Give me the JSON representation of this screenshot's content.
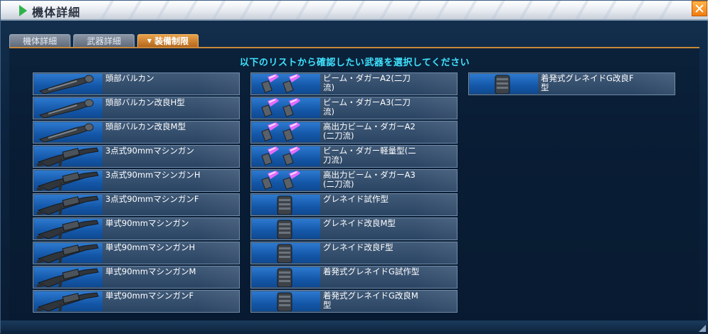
{
  "window": {
    "title": "機体詳細"
  },
  "tabs": [
    {
      "label": "機体詳細"
    },
    {
      "label": "武器詳細"
    },
    {
      "label": "装備制限"
    }
  ],
  "prompt": "以下のリストから確認したい武器を選択してください",
  "weapons": {
    "column1": [
      {
        "name": "頭部バルカン",
        "icon": "vulcan-icon"
      },
      {
        "name": "頭部バルカン改良H型",
        "icon": "vulcan-icon"
      },
      {
        "name": "頭部バルカン改良M型",
        "icon": "vulcan-icon"
      },
      {
        "name": "3点式90mmマシンガン",
        "icon": "machine-gun-icon"
      },
      {
        "name": "3点式90mmマシンガンH",
        "icon": "machine-gun-icon"
      },
      {
        "name": "3点式90mmマシンガンF",
        "icon": "machine-gun-icon"
      },
      {
        "name": "単式90mmマシンガン",
        "icon": "machine-gun-icon"
      },
      {
        "name": "単式90mmマシンガンH",
        "icon": "machine-gun-icon"
      },
      {
        "name": "単式90mmマシンガンM",
        "icon": "machine-gun-icon"
      },
      {
        "name": "単式90mmマシンガンF",
        "icon": "machine-gun-icon"
      }
    ],
    "column2": [
      {
        "name": "ビーム・ダガーA2(二刀\n流)",
        "icon": "beam-dagger-icon"
      },
      {
        "name": "ビーム・ダガーA3(二刀\n流)",
        "icon": "beam-dagger-icon"
      },
      {
        "name": "高出力ビーム・ダガーA2\n(二刀流)",
        "icon": "beam-dagger-icon"
      },
      {
        "name": "ビーム・ダガー軽量型(二\n刀流)",
        "icon": "beam-dagger-icon"
      },
      {
        "name": "高出力ビーム・ダガーA3\n(二刀流)",
        "icon": "beam-dagger-icon"
      },
      {
        "name": "グレネイド試作型",
        "icon": "grenade-icon"
      },
      {
        "name": "グレネイド改良M型",
        "icon": "grenade-icon"
      },
      {
        "name": "グレネイド改良F型",
        "icon": "grenade-icon"
      },
      {
        "name": "着発式グレネイドG試作型",
        "icon": "grenade-icon"
      },
      {
        "name": "着発式グレネイドG改良M\n型",
        "icon": "grenade-icon"
      }
    ],
    "column3": [
      {
        "name": "着発式グレネイドG改良F\n型",
        "icon": "grenade-icon"
      }
    ]
  },
  "colors": {
    "accent": "#3fe3ff",
    "tab_active": "#e7a24a",
    "thumb_bg": "#1f6bc0",
    "beam": "#d638ff"
  }
}
